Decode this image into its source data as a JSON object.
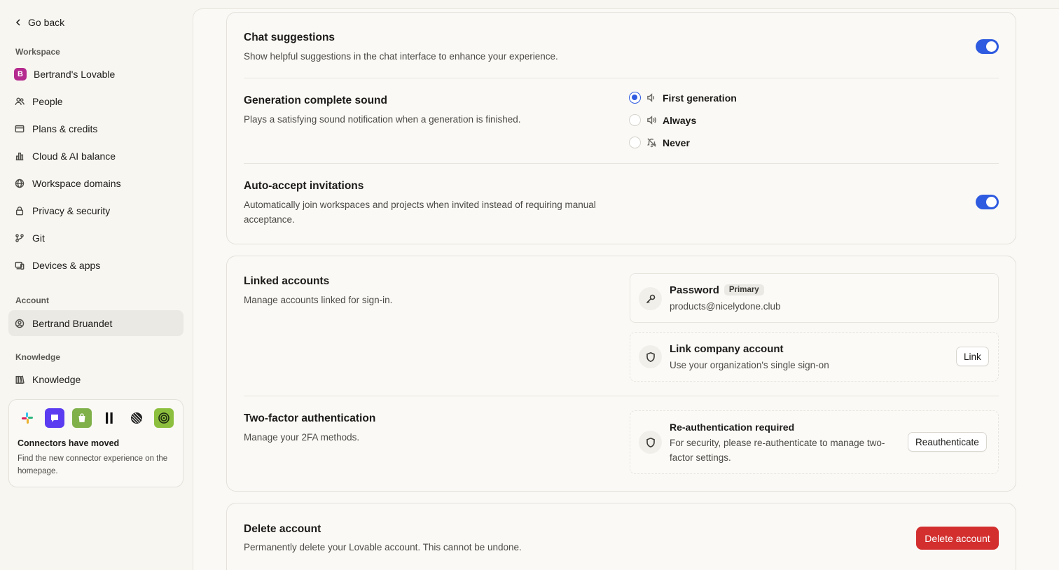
{
  "sidebar": {
    "go_back": "Go back",
    "workspace_label": "Workspace",
    "workspace_items": [
      {
        "label": "Bertrand's Lovable",
        "badge": "B"
      },
      {
        "label": "People"
      },
      {
        "label": "Plans & credits"
      },
      {
        "label": "Cloud & AI balance"
      },
      {
        "label": "Workspace domains"
      },
      {
        "label": "Privacy & security"
      },
      {
        "label": "Git"
      },
      {
        "label": "Devices & apps"
      }
    ],
    "account_label": "Account",
    "account_items": [
      {
        "label": "Bertrand Bruandet"
      }
    ],
    "knowledge_label": "Knowledge",
    "knowledge_items": [
      {
        "label": "Knowledge"
      }
    ],
    "connectors": {
      "title": "Connectors have moved",
      "text": "Find the new connector experience on the homepage."
    }
  },
  "settings": {
    "chat_suggestions": {
      "title": "Chat suggestions",
      "desc": "Show helpful suggestions in the chat interface to enhance your experience.",
      "enabled": true
    },
    "generation_sound": {
      "title": "Generation complete sound",
      "desc": "Plays a satisfying sound notification when a generation is finished.",
      "options": [
        "First generation",
        "Always",
        "Never"
      ],
      "selected": "First generation"
    },
    "auto_accept": {
      "title": "Auto-accept invitations",
      "desc": "Automatically join workspaces and projects when invited instead of requiring manual acceptance.",
      "enabled": true
    }
  },
  "linked_accounts": {
    "title": "Linked accounts",
    "desc": "Manage accounts linked for sign-in.",
    "password": {
      "title": "Password",
      "badge": "Primary",
      "email": "products@nicelydone.club"
    },
    "company": {
      "title": "Link company account",
      "desc": "Use your organization's single sign-on",
      "button": "Link"
    }
  },
  "two_factor": {
    "title": "Two-factor authentication",
    "desc": "Manage your 2FA methods.",
    "reauth": {
      "title": "Re-authentication required",
      "desc": "For security, please re-authenticate to manage two-factor settings.",
      "button": "Reauthenticate"
    }
  },
  "delete_account": {
    "title": "Delete account",
    "desc": "Permanently delete your Lovable account. This cannot be undone.",
    "button": "Delete account"
  },
  "colors": {
    "accent": "#2f5be0",
    "danger": "#d32f2f",
    "workspace_badge": "#b52a8f"
  }
}
